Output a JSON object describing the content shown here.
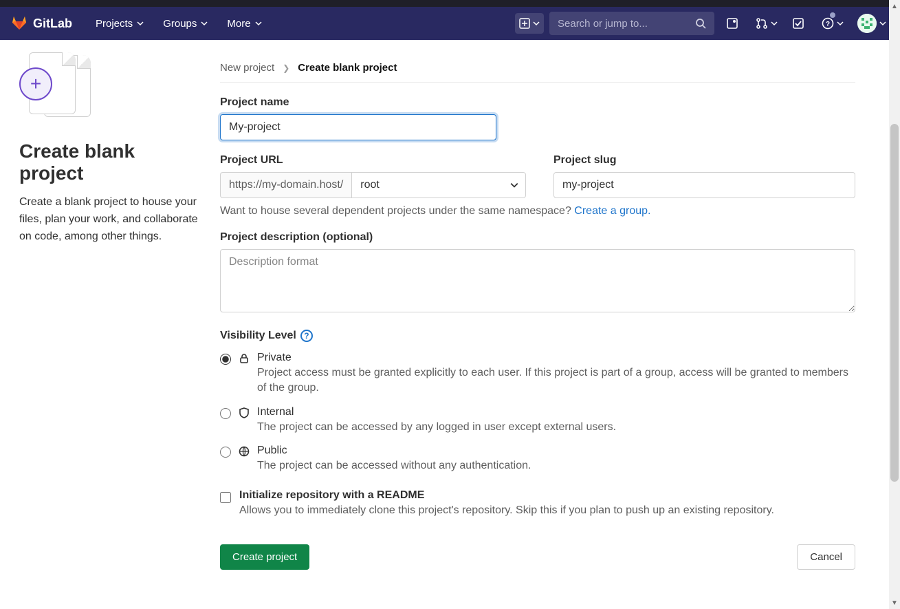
{
  "brand": {
    "name": "GitLab"
  },
  "nav": {
    "projects": "Projects",
    "groups": "Groups",
    "more": "More",
    "search_placeholder": "Search or jump to..."
  },
  "breadcrumb": {
    "parent": "New project",
    "current": "Create blank project"
  },
  "left": {
    "title": "Create blank project",
    "desc": "Create a blank project to house your files, plan your work, and collaborate on code, among other things."
  },
  "form": {
    "project_name_label": "Project name",
    "project_name_value": "My-project",
    "project_url_label": "Project URL",
    "project_url_prefix": "https://my-domain.host/",
    "namespace_selected": "root",
    "project_slug_label": "Project slug",
    "project_slug_value": "my-project",
    "namespace_hint_prefix": "Want to house several dependent projects under the same namespace? ",
    "namespace_hint_link": "Create a group.",
    "description_label": "Project description (optional)",
    "description_placeholder": "Description format",
    "visibility_label": "Visibility Level",
    "visibility": {
      "private": {
        "title": "Private",
        "desc": "Project access must be granted explicitly to each user. If this project is part of a group, access will be granted to members of the group."
      },
      "internal": {
        "title": "Internal",
        "desc": "The project can be accessed by any logged in user except external users."
      },
      "public": {
        "title": "Public",
        "desc": "The project can be accessed without any authentication."
      }
    },
    "readme_title": "Initialize repository with a README",
    "readme_desc": "Allows you to immediately clone this project's repository. Skip this if you plan to push up an existing repository.",
    "submit": "Create project",
    "cancel": "Cancel"
  }
}
